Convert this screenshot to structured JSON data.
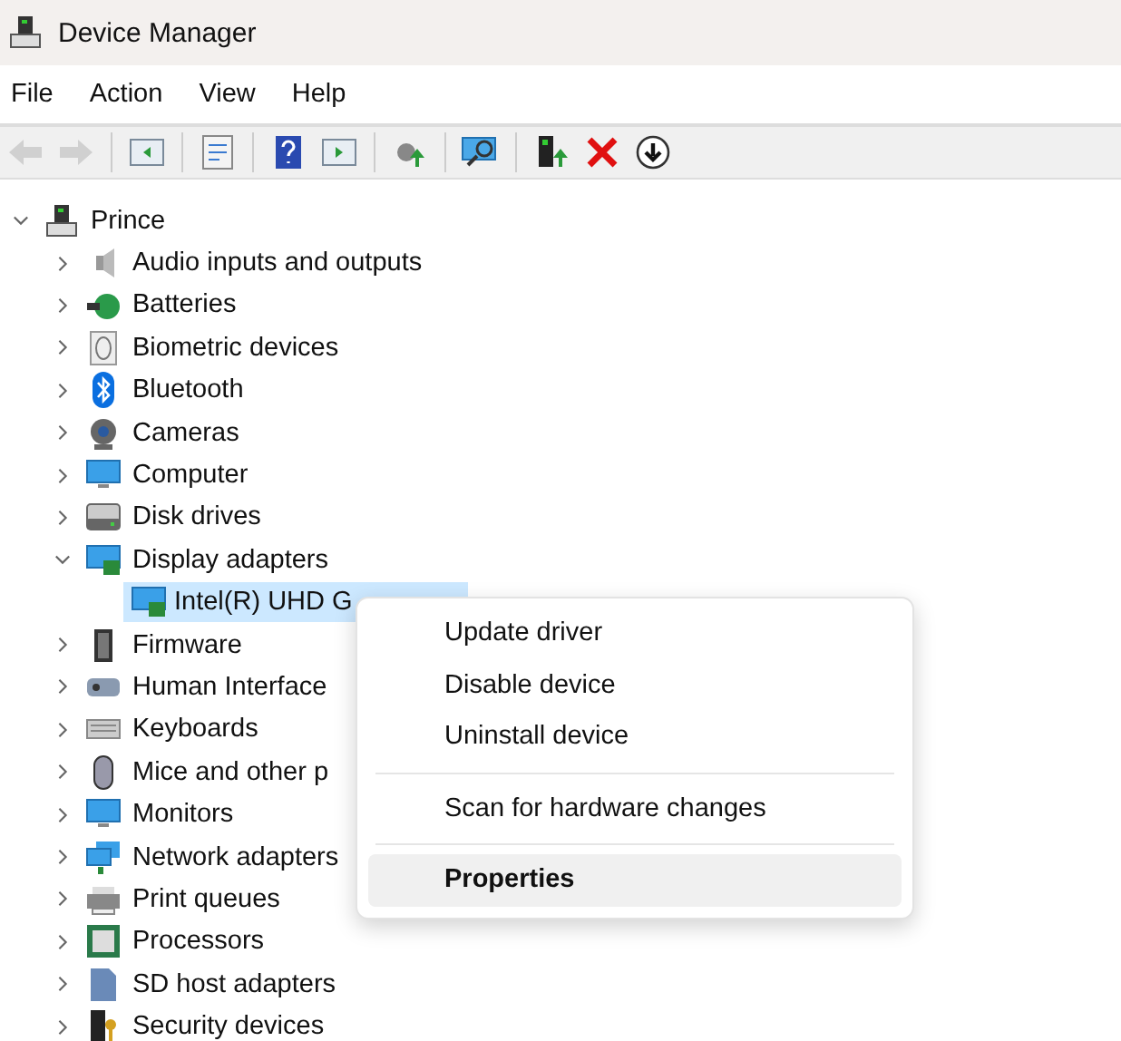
{
  "window": {
    "title": "Device Manager"
  },
  "menu": [
    "File",
    "Action",
    "View",
    "Help"
  ],
  "toolbar": [
    {
      "disabled": true
    },
    {
      "disabled": true
    },
    {
      "disabled": false
    },
    {
      "disabled": false
    },
    {
      "disabled": false
    },
    {
      "disabled": false
    },
    {
      "disabled": false
    },
    {
      "disabled": false
    },
    {
      "disabled": false
    },
    {
      "disabled": false
    },
    {
      "disabled": false
    }
  ],
  "tree": {
    "label": "Prince",
    "expanded": true,
    "selected": false,
    "children": [
      {
        "label": "Audio inputs and outputs",
        "expanded": false,
        "selected": false
      },
      {
        "label": "Batteries",
        "expanded": false,
        "selected": false
      },
      {
        "label": "Biometric devices",
        "expanded": false,
        "selected": false
      },
      {
        "label": "Bluetooth",
        "expanded": false,
        "selected": false
      },
      {
        "label": "Cameras",
        "expanded": false,
        "selected": false
      },
      {
        "label": "Computer",
        "expanded": false,
        "selected": false
      },
      {
        "label": "Disk drives",
        "expanded": false,
        "selected": false
      },
      {
        "label": "Display adapters",
        "expanded": true,
        "selected": false,
        "children": [
          {
            "label": "Intel(R) UHD G",
            "selected": true
          }
        ]
      },
      {
        "label": "Firmware",
        "expanded": false,
        "selected": false
      },
      {
        "label": "Human Interface",
        "expanded": false,
        "selected": false
      },
      {
        "label": "Keyboards",
        "expanded": false,
        "selected": false
      },
      {
        "label": "Mice and other p",
        "expanded": false,
        "selected": false
      },
      {
        "label": "Monitors",
        "expanded": false,
        "selected": false
      },
      {
        "label": "Network adapters",
        "expanded": false,
        "selected": false
      },
      {
        "label": "Print queues",
        "expanded": false,
        "selected": false
      },
      {
        "label": "Processors",
        "expanded": false,
        "selected": false
      },
      {
        "label": "SD host adapters",
        "expanded": false,
        "selected": false
      },
      {
        "label": "Security devices",
        "expanded": false,
        "selected": false
      }
    ]
  },
  "context_menu": [
    {
      "kind": "item",
      "label": "Update driver",
      "default": false,
      "selected": false
    },
    {
      "kind": "item",
      "label": "Disable device",
      "default": false,
      "selected": false
    },
    {
      "kind": "item",
      "label": "Uninstall device",
      "default": false,
      "selected": false
    },
    {
      "kind": "separator"
    },
    {
      "kind": "item",
      "label": "Scan for hardware changes",
      "default": false,
      "selected": false
    },
    {
      "kind": "separator"
    },
    {
      "kind": "item",
      "label": "Properties",
      "default": true,
      "selected": true
    }
  ]
}
